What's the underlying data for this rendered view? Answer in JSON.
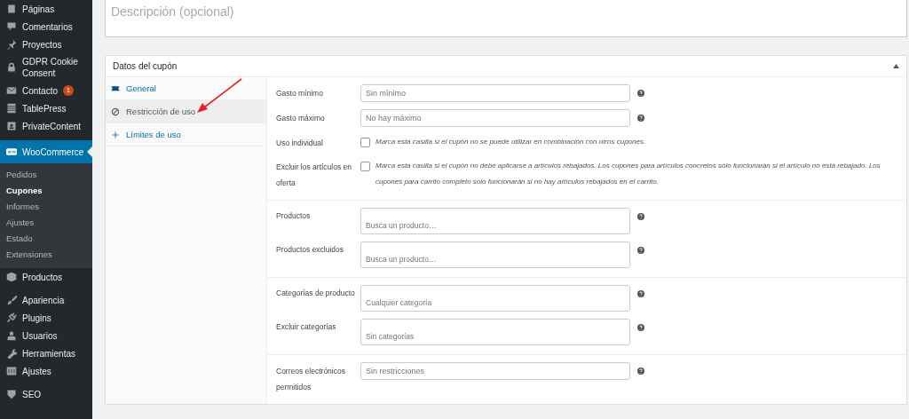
{
  "sidebar": {
    "menu_groups": [
      [
        {
          "label": "Páginas",
          "selected": false
        },
        {
          "label": "Comentarios",
          "selected": false
        },
        {
          "label": "Proyectos",
          "selected": false
        },
        {
          "label": "GDPR Cookie Consent",
          "selected": false
        },
        {
          "label": "Contacto",
          "selected": false,
          "badge": "1"
        },
        {
          "label": "TablePress",
          "selected": false
        },
        {
          "label": "PrivateContent",
          "selected": false
        }
      ],
      [
        {
          "label": "WooCommerce",
          "selected": true,
          "children": [
            {
              "label": "Pedidos",
              "selected": false
            },
            {
              "label": "Cupones",
              "selected": true
            },
            {
              "label": "Informes",
              "selected": false
            },
            {
              "label": "Ajustes",
              "selected": false
            },
            {
              "label": "Estado",
              "selected": false
            },
            {
              "label": "Extensiones",
              "selected": false
            }
          ]
        },
        {
          "label": "Productos",
          "selected": false
        }
      ],
      [
        {
          "label": "Apariencia",
          "selected": false
        },
        {
          "label": "Plugins",
          "selected": false
        },
        {
          "label": "Usuarios",
          "selected": false
        },
        {
          "label": "Herramientas",
          "selected": false
        },
        {
          "label": "Ajustes",
          "selected": false
        }
      ],
      [
        {
          "label": "SEO",
          "selected": false
        }
      ]
    ]
  },
  "description": {
    "placeholder": "Descripción (opcional)"
  },
  "coupon_panel": {
    "title": "Datos del cupón",
    "expanded": true,
    "tabs": [
      {
        "label": "General",
        "selected": false
      },
      {
        "label": "Restricción de uso",
        "selected": true
      },
      {
        "label": "Límites de uso",
        "selected": false
      }
    ],
    "sections": [
      [
        {
          "kind": "text",
          "label": "Gasto mínimo",
          "placeholder": "Sin mínimo",
          "help": true
        },
        {
          "kind": "text",
          "label": "Gasto máximo",
          "placeholder": "No hay máximo",
          "help": true
        },
        {
          "kind": "checkbox",
          "label": "Uso individual",
          "checked": false,
          "description": "Marca esta casilla si el cupón no se puede utilizar en combinación con otros cupones."
        },
        {
          "kind": "checkbox",
          "label": "Excluir los artículos en oferta",
          "checked": false,
          "description": "Marca esta casilla si el cupón no debe aplicarse a artículos rebajados. Los cupones para artículos concretos sólo funcionarán si el artículo no está rebajado. Los cupones para carrito completo solo funcionarán si no hay artículos rebajados en el carrito."
        }
      ],
      [
        {
          "kind": "search",
          "label": "Productos",
          "placeholder": "Busca un producto…",
          "help": true
        },
        {
          "kind": "search",
          "label": "Productos excluidos",
          "placeholder": "Busca un producto…",
          "help": true
        }
      ],
      [
        {
          "kind": "search",
          "label": "Categorías de producto",
          "placeholder": "Cualquier categoría",
          "help": true
        },
        {
          "kind": "search",
          "label": "Excluir categorías",
          "placeholder": "Sin categorías",
          "help": true
        }
      ],
      [
        {
          "kind": "text",
          "label": "Correos electrónicos permitidos",
          "placeholder": "Sin restricciones",
          "help": true
        }
      ]
    ]
  }
}
